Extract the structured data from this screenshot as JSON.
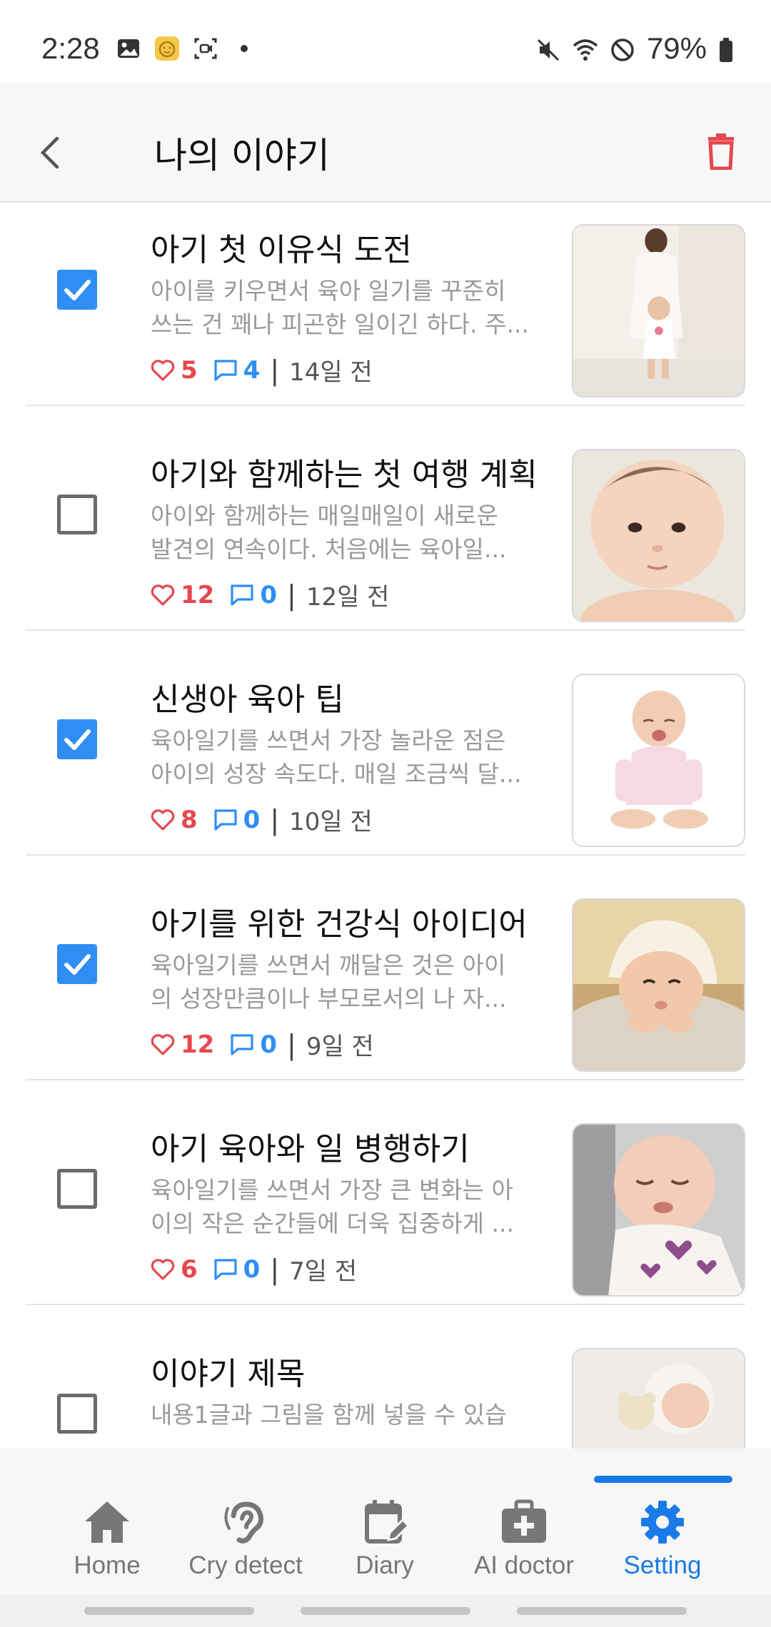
{
  "status_bar": {
    "time": "2:28",
    "battery": "79%",
    "left_icons": [
      "gallery-icon",
      "baby-face-icon",
      "screen-record-icon",
      "dot-icon"
    ],
    "right_icons": [
      "mute-icon",
      "wifi-icon",
      "blocked-icon",
      "battery-icon"
    ]
  },
  "header": {
    "title": "나의 이야기",
    "back_icon": "chevron-left-icon",
    "delete_icon": "trash-icon",
    "delete_color": "#e5484d"
  },
  "stories": [
    {
      "title": "아기 첫 이유식 도전",
      "preview_lines": [
        "아이를 키우면서 육아 일기를 꾸준히",
        "쓰는 건 꽤나 피곤한 일이긴 하다. 주..."
      ],
      "likes": "5",
      "comments": "4",
      "ago": "14일 전",
      "checked": true,
      "thumb": "mother-walking-baby"
    },
    {
      "title": "아기와 함께하는 첫 여행 계획",
      "preview_lines": [
        "아이와 함께하는 매일매일이 새로운",
        "발견의 연속이다. 처음에는 육아일..."
      ],
      "likes": "12",
      "comments": "0",
      "ago": "12일 전",
      "checked": false,
      "thumb": "baby-closeup"
    },
    {
      "title": "신생아 육아 팁",
      "preview_lines": [
        "육아일기를 쓰면서 가장 놀라운 점은",
        "아이의 성장 속도다. 매일 조금씩 달..."
      ],
      "likes": "8",
      "comments": "0",
      "ago": "10일 전",
      "checked": true,
      "thumb": "baby-crying-sitting"
    },
    {
      "title": "아기를 위한 건강식 아이디어",
      "preview_lines": [
        "육아일기를 쓰면서 깨달은 것은 아이",
        "의 성장만큼이나 부모로서의 나 자..."
      ],
      "likes": "12",
      "comments": "0",
      "ago": "9일 전",
      "checked": true,
      "thumb": "baby-bonnet"
    },
    {
      "title": "아기 육아와 일 병행하기",
      "preview_lines": [
        "육아일기를 쓰면서 가장 큰 변화는 아",
        "이의 작은 순간들에 더욱 집중하게 ..."
      ],
      "likes": "6",
      "comments": "0",
      "ago": "7일 전",
      "checked": false,
      "thumb": "baby-sleeping"
    },
    {
      "title": "이야기 제목",
      "preview_lines": [
        "내용1글과 그림을 함께 넣을 수 있습",
        ""
      ],
      "likes": "",
      "comments": "",
      "ago": "",
      "checked": false,
      "thumb": "baby-with-teddy"
    }
  ],
  "bottom_nav": {
    "items": [
      {
        "label": "Home",
        "icon": "home-icon",
        "active": false
      },
      {
        "label": "Cry detect",
        "icon": "ear-icon",
        "active": false
      },
      {
        "label": "Diary",
        "icon": "calendar-edit-icon",
        "active": false
      },
      {
        "label": "AI doctor",
        "icon": "medical-kit-icon",
        "active": false
      },
      {
        "label": "Setting",
        "icon": "gear-icon",
        "active": true
      }
    ],
    "active_color": "#1a7ae8",
    "inactive_color": "#777777"
  },
  "colors": {
    "accent": "#2f8ef4",
    "like": "#e5484d",
    "comment": "#2f8ef4"
  }
}
